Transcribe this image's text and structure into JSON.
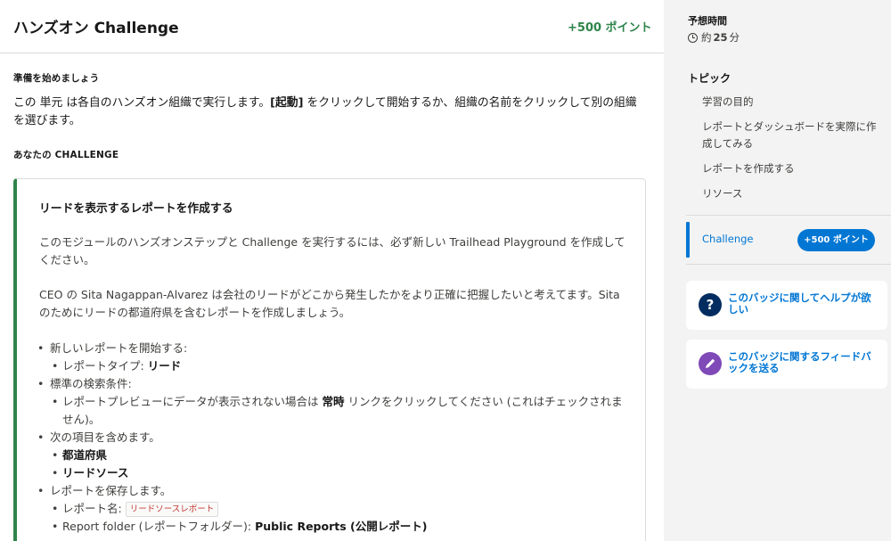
{
  "header": {
    "title": "ハンズオン Challenge",
    "points": "+500 ポイント"
  },
  "prep": {
    "heading": "準備を始めましょう",
    "text_1": "この 単元 は各自のハンズオン組織で実行します。",
    "launch": "[起動]",
    "text_2": " をクリックして開始するか、組織の名前をクリックして別の組織を選びます。"
  },
  "your_challenge_heading": "あなたの CHALLENGE",
  "challenge": {
    "title": "リードを表示するレポートを作成する",
    "para1": "このモジュールのハンズオンステップと Challenge を実行するには、必ず新しい Trailhead Playground を作成してください。",
    "para2": "CEO の Sita Nagappan-Alvarez は会社のリードがどこから発生したかをより正確に把握したいと考えてます。Sita のためにリードの都道府県を含むレポートを作成しましょう。",
    "steps": {
      "s1": "新しいレポートを開始する:",
      "s1_a_label": "レポートタイプ: ",
      "s1_a_value": "リード",
      "s2": "標準の検索条件:",
      "s2_a_1": "レポートプレビューにデータが表示されない場合は ",
      "s2_a_bold": "常時",
      "s2_a_2": " リンクをクリックしてください (これはチェックされません)。",
      "s3": "次の項目を含めます。",
      "s3_a": "都道府県",
      "s3_b": "リードソース",
      "s4": "レポートを保存します。",
      "s4_a_label": "レポート名: ",
      "s4_a_value": "リードソースレポート",
      "s4_b_label": "Report folder (レポートフォルダー): ",
      "s4_b_value": "Public Reports (公開レポート)"
    }
  },
  "sidebar": {
    "est_label": "予想時間",
    "est_prefix": "約",
    "est_value": "25",
    "est_unit": "分",
    "topics_label": "トピック",
    "topics": [
      "学習の目的",
      "レポートとダッシュボードを実際に作成してみる",
      "レポートを作成する",
      "リソース"
    ],
    "challenge_label": "Challenge",
    "challenge_points": "+500 ポイント",
    "help_text": "このバッジに関してヘルプが欲しい",
    "feedback_text": "このバッジに関するフィードバックを送る",
    "help_icon": "question-icon",
    "feedback_icon": "pencil-icon",
    "colors": {
      "accent": "#0176d3",
      "points_green": "#2e844a",
      "help_icon_bg": "#032d60",
      "feedback_icon_bg": "#7f49b8"
    }
  }
}
